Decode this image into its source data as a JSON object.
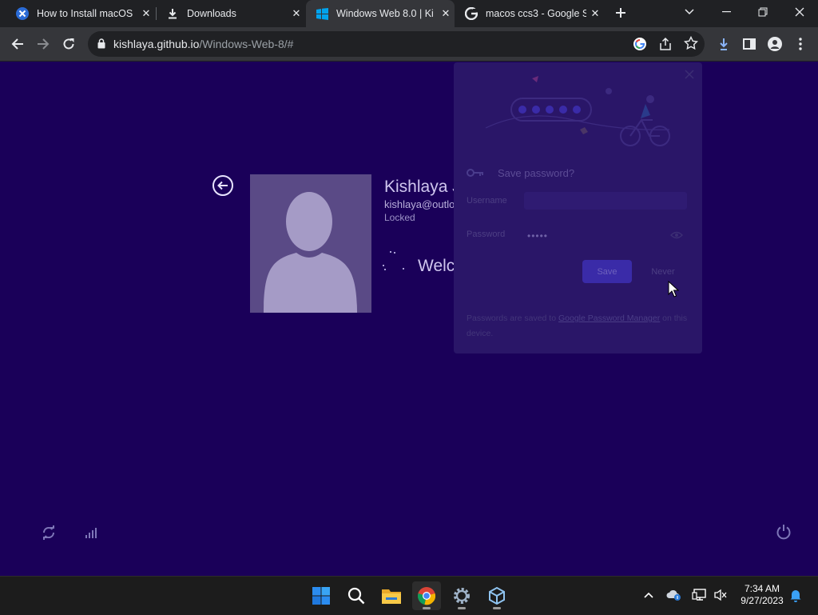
{
  "browser": {
    "tabs": [
      {
        "title": "How to Install macOS",
        "favicon": "kb-logo-icon",
        "active": false
      },
      {
        "title": "Downloads",
        "favicon": "download-icon",
        "active": false
      },
      {
        "title": "Windows Web 8.0 | Ki",
        "favicon": "windows-logo-icon",
        "active": true
      },
      {
        "title": "macos ccs3 - Google S",
        "favicon": "google-icon",
        "active": false
      }
    ],
    "address": {
      "host": "kishlaya.github.io",
      "path": "/Windows-Web-8/#"
    }
  },
  "lock_screen": {
    "user_name": "Kishlaya Jaiswal",
    "email": "kishlaya@outlook.com",
    "status": "Locked",
    "welcome": "Welcome",
    "background_color": "#1a0059"
  },
  "save_password": {
    "title": "Save password?",
    "username_label": "Username",
    "password_label": "Password",
    "password_value": "•••••",
    "save_label": "Save",
    "never_label": "Never",
    "footer_prefix": "Passwords are saved to ",
    "footer_link": "Google Password Manager",
    "footer_suffix": " on this device."
  },
  "taskbar": {
    "apps": [
      "windows-start-icon",
      "search-icon",
      "file-explorer-icon",
      "chrome-icon",
      "settings-icon",
      "virtualbox-icon"
    ],
    "time": "7:34 AM",
    "date": "9/27/2023"
  }
}
